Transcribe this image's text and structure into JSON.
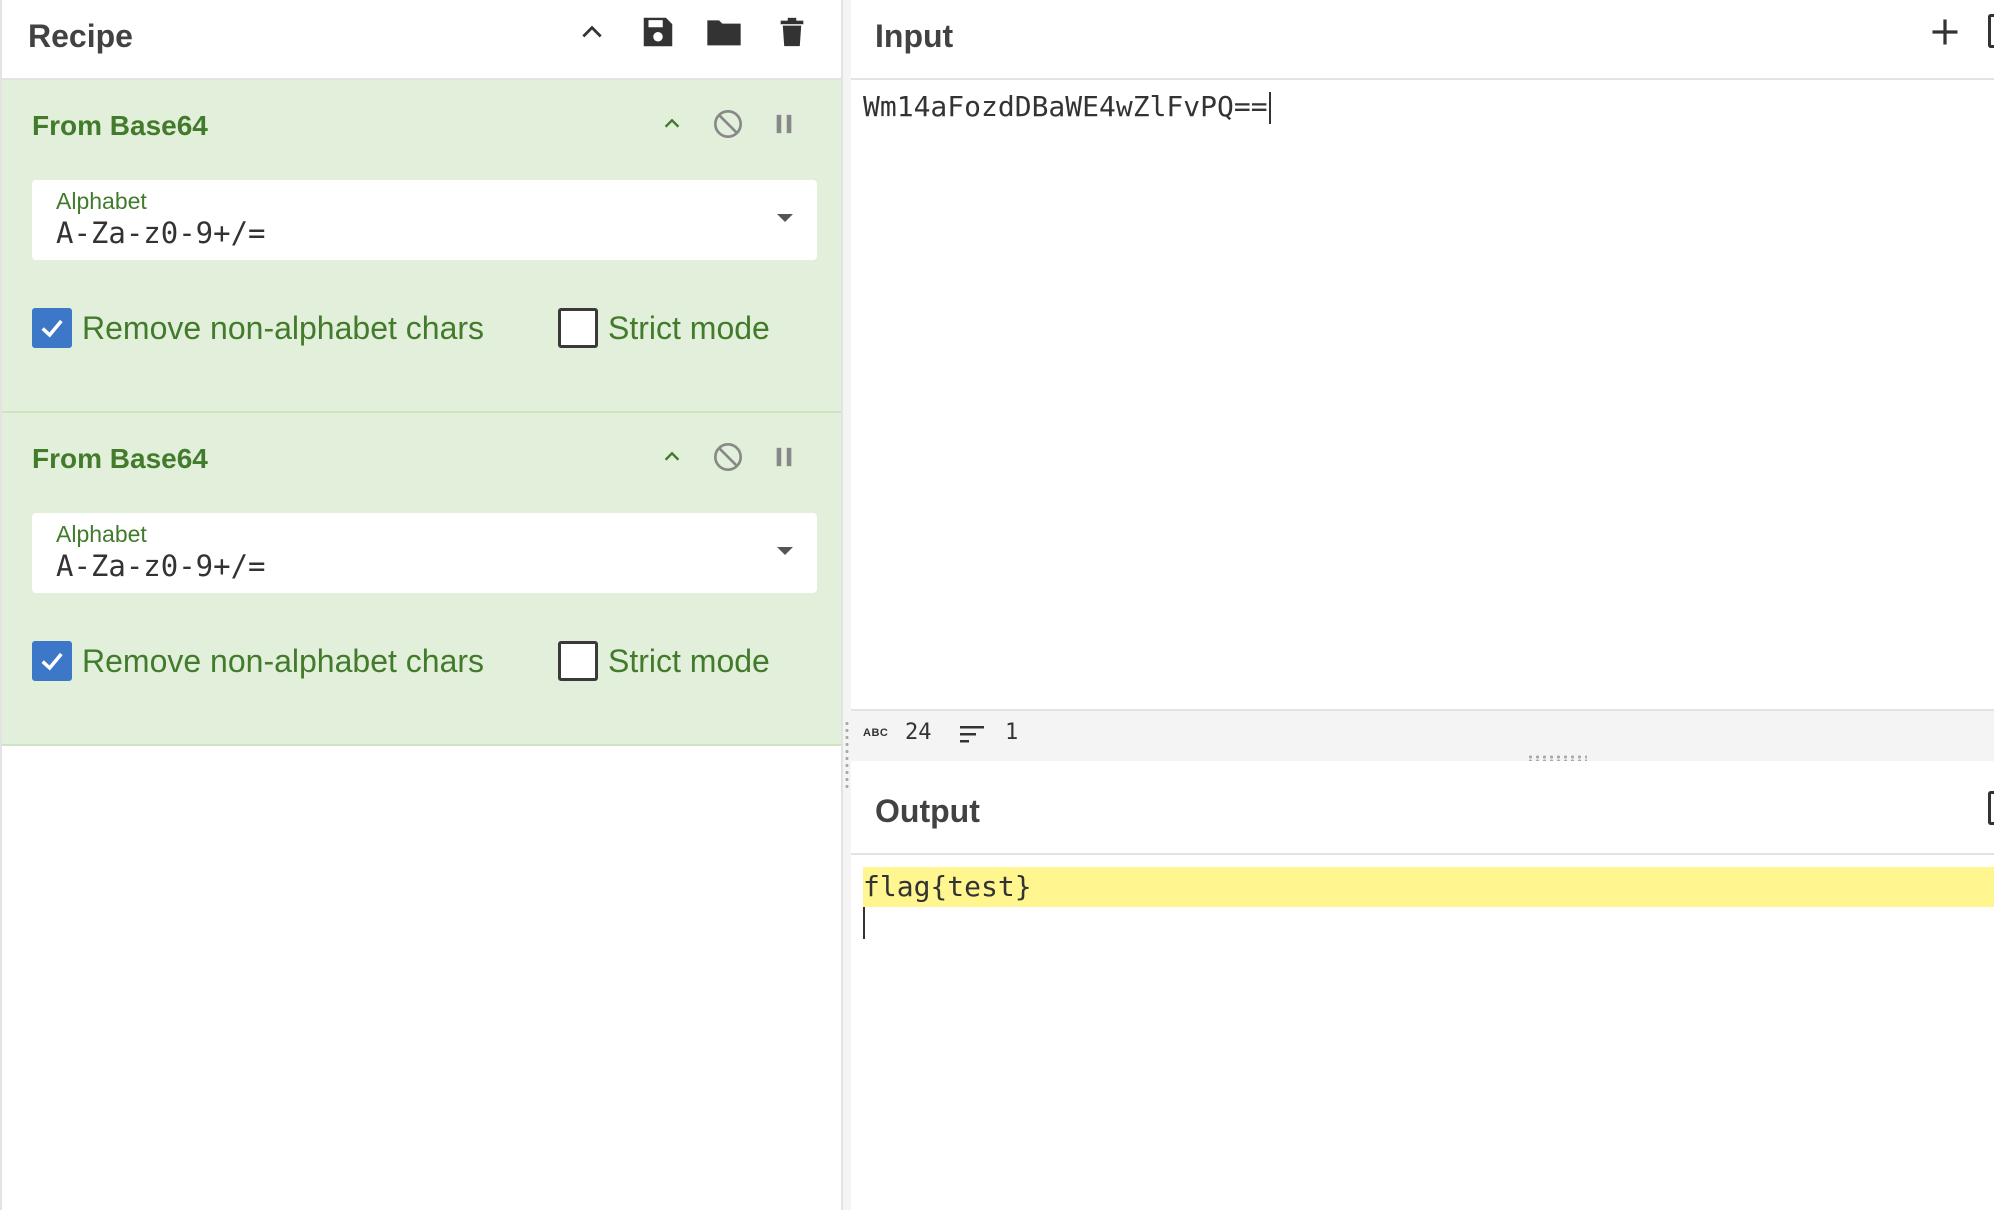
{
  "recipe": {
    "title": "Recipe",
    "header_icons": [
      "chevron-up-icon",
      "save-icon",
      "folder-icon",
      "trash-icon"
    ],
    "operations": [
      {
        "name": "From Base64",
        "controls": [
          "chevron-up-icon",
          "disable-icon",
          "pause-icon"
        ],
        "alphabet_label": "Alphabet",
        "alphabet_value": "A-Za-z0-9+/=",
        "remove_label": "Remove non-alphabet chars",
        "remove_checked": true,
        "strict_label": "Strict mode",
        "strict_checked": false
      },
      {
        "name": "From Base64",
        "controls": [
          "chevron-up-icon",
          "disable-icon",
          "pause-icon"
        ],
        "alphabet_label": "Alphabet",
        "alphabet_value": "A-Za-z0-9+/=",
        "remove_label": "Remove non-alphabet chars",
        "remove_checked": true,
        "strict_label": "Strict mode",
        "strict_checked": false
      }
    ]
  },
  "input": {
    "title": "Input",
    "text": "Wm14aFozdDBaWE4wZlFvPQ==",
    "stats": {
      "abc_label": "ABC",
      "length": "24",
      "lines": "1"
    }
  },
  "output": {
    "title": "Output",
    "text": "flag{test}"
  },
  "colors": {
    "operation_bg": "#e2efda",
    "operation_text": "#427b2c",
    "checkbox_checked": "#3d78c8",
    "output_highlight": "#fff68f"
  }
}
